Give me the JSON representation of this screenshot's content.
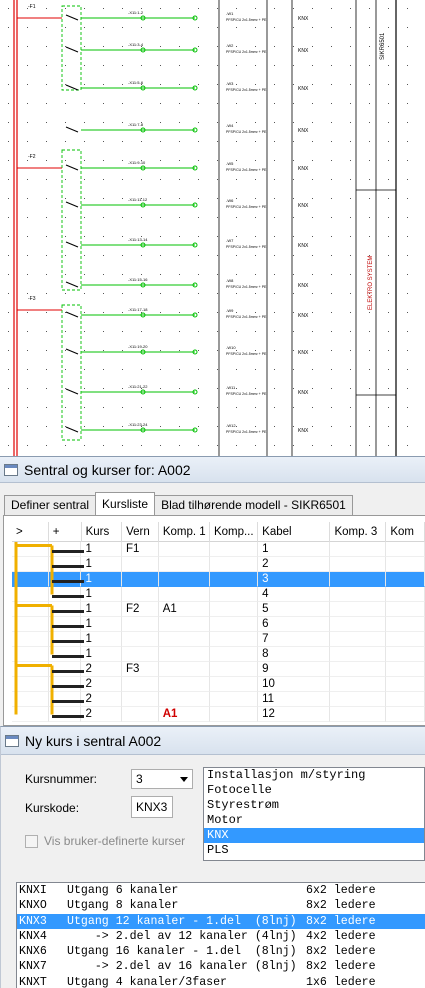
{
  "schematic": {
    "circuit_ids": [
      "-X11:1-2",
      "-X11:3-4",
      "-X11:5-6",
      "-X11:7-8",
      "-X11:9-10",
      "-X11:11-12",
      "-X11:13-14",
      "-X11:15-16",
      "-X11:17-18",
      "-X11:19-20",
      "-X11:21-22",
      "-X11:23-24"
    ],
    "cable_labels": [
      "-W1",
      "-W2",
      "-W3",
      "-W4",
      "-W5",
      "-W6",
      "-W7",
      "-W8",
      "-W9",
      "-W10",
      "-W11",
      "-W12"
    ],
    "cable_type": "PFSP/CU 2x1.5mm² + PE",
    "kurs_tag": "KNX",
    "breaker_labels": [
      "-F1",
      "-F2",
      "-F3"
    ],
    "title_block_text": "SIKR6501",
    "logo_text": "ELEKTRO SYSTEM"
  },
  "window1": {
    "title": "Sentral og kurser for: A002",
    "tabs": [
      "Definer sentral",
      "Kursliste",
      "Blad tilhørende modell - SIKR6501"
    ],
    "active_tab": 1,
    "columns": [
      ">",
      "+",
      "Kurs",
      "Vern",
      "Komp. 1",
      "Komp...",
      "Kabel",
      "Komp. 3",
      "Kom"
    ],
    "rows": [
      {
        "kurs": "1",
        "vern": "F1",
        "komp1": "",
        "kabel": "1",
        "selected": false
      },
      {
        "kurs": "1",
        "vern": "",
        "komp1": "",
        "kabel": "2",
        "selected": false
      },
      {
        "kurs": "1",
        "vern": "",
        "komp1": "",
        "kabel": "3",
        "selected": true
      },
      {
        "kurs": "1",
        "vern": "",
        "komp1": "",
        "kabel": "4",
        "selected": false
      },
      {
        "kurs": "1",
        "vern": "F2",
        "komp1": "A1",
        "kabel": "5",
        "selected": false
      },
      {
        "kurs": "1",
        "vern": "",
        "komp1": "",
        "kabel": "6",
        "selected": false
      },
      {
        "kurs": "1",
        "vern": "",
        "komp1": "",
        "kabel": "7",
        "selected": false
      },
      {
        "kurs": "1",
        "vern": "",
        "komp1": "",
        "kabel": "8",
        "selected": false
      },
      {
        "kurs": "2",
        "vern": "F3",
        "komp1": "",
        "kabel": "9",
        "selected": false
      },
      {
        "kurs": "2",
        "vern": "",
        "komp1": "",
        "kabel": "10",
        "selected": false
      },
      {
        "kurs": "2",
        "vern": "",
        "komp1": "",
        "kabel": "11",
        "selected": false
      },
      {
        "kurs": "2",
        "vern": "",
        "komp1": "A1",
        "kabel": "12",
        "selected": false
      }
    ]
  },
  "window2": {
    "title": "Ny kurs i sentral  A002",
    "kursnummer_label": "Kursnummer:",
    "kursnummer_value": "3",
    "kurskode_label": "Kurskode:",
    "kurskode_value": "KNX3",
    "checkbox_label": "Vis bruker-definerte kurser",
    "types": [
      "Installasjon m/styring",
      "Fotocelle",
      "Styrestrøm",
      "Motor",
      "KNX",
      "PLS"
    ],
    "selected_type": 4,
    "kurs_rows": [
      {
        "code": "KNXI",
        "desc": "Utgang 6 kanaler",
        "wire": "6x2 ledere",
        "selected": false
      },
      {
        "code": "KNXO",
        "desc": "Utgang 8 kanaler",
        "wire": "8x2 ledere",
        "selected": false
      },
      {
        "code": "KNX3",
        "desc": "Utgang 12 kanaler - 1.del  (8lnj)",
        "wire": "8x2 ledere",
        "selected": true
      },
      {
        "code": "KNX4",
        "desc": "    -> 2.del av 12 kanaler (4lnj)",
        "wire": "4x2 ledere",
        "selected": false
      },
      {
        "code": "KNX6",
        "desc": "Utgang 16 kanaler - 1.del  (8lnj)",
        "wire": "8x2 ledere",
        "selected": false
      },
      {
        "code": "KNX7",
        "desc": "    -> 2.del av 16 kanaler (8lnj)",
        "wire": "8x2 ledere",
        "selected": false
      },
      {
        "code": "KNXT",
        "desc": "Utgang 4 kanaler/3faser",
        "wire": "1x6 ledere",
        "selected": false
      }
    ]
  },
  "colors": {
    "circuit_green": "#00c000",
    "circuit_red": "#e00000",
    "tree_orange": "#f0b000",
    "selection_blue": "#3399ff",
    "warning_red": "#d00000"
  }
}
